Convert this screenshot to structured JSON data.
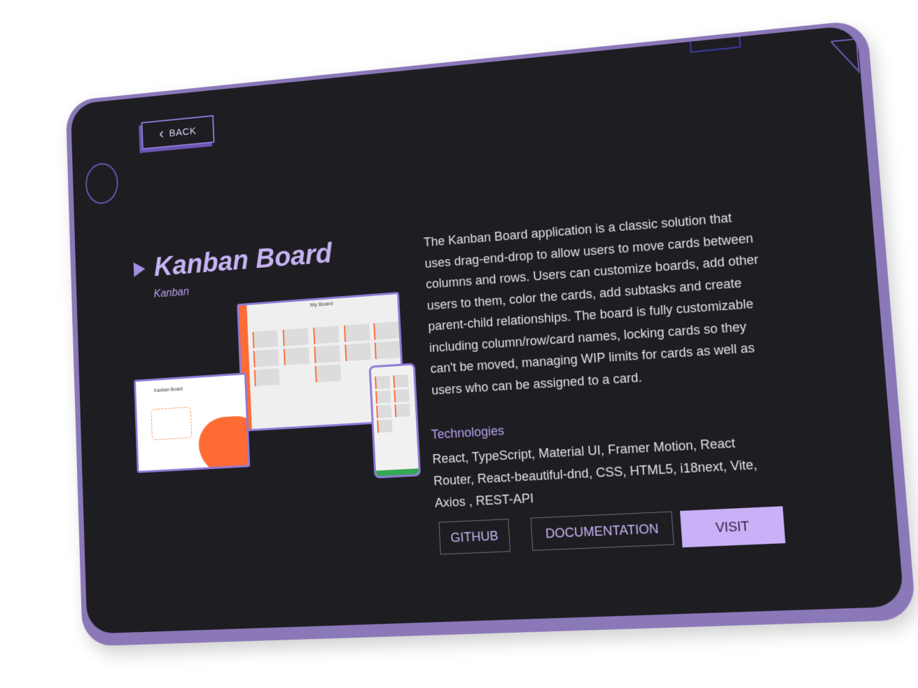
{
  "nav": {
    "back_label": "BACK"
  },
  "project": {
    "title": "Kanban Board",
    "subtitle": "Kanban",
    "description": "The Kanban Board application is a classic solution that uses drag-end-drop to allow users to move cards between columns and rows. Users can customize boards, add other users to them, color the cards, add subtasks and create parent-child relationships. The board is fully customizable including column/row/card names, locking cards so they can't be moved, managing WIP limits for cards as well as users who can be assigned to a card.",
    "technologies_heading": "Technologies",
    "technologies": "React, TypeScript, Material UI, Framer Motion, React Router, React-beautiful-dnd, CSS, HTML5, i18next, Vite, Axios , REST-API"
  },
  "mockup": {
    "desktop_board_title": "My Board",
    "laptop_title": "Kanban Board"
  },
  "actions": {
    "github_label": "GITHUB",
    "docs_label": "DOCUMENTATION",
    "visit_label": "VISIT"
  },
  "colors": {
    "frame": "#8a78b8",
    "screen": "#1e1d22",
    "accent": "#c5b3f3",
    "visit_button": "#c9b0f7",
    "mockup_orange": "#ff6b35"
  }
}
